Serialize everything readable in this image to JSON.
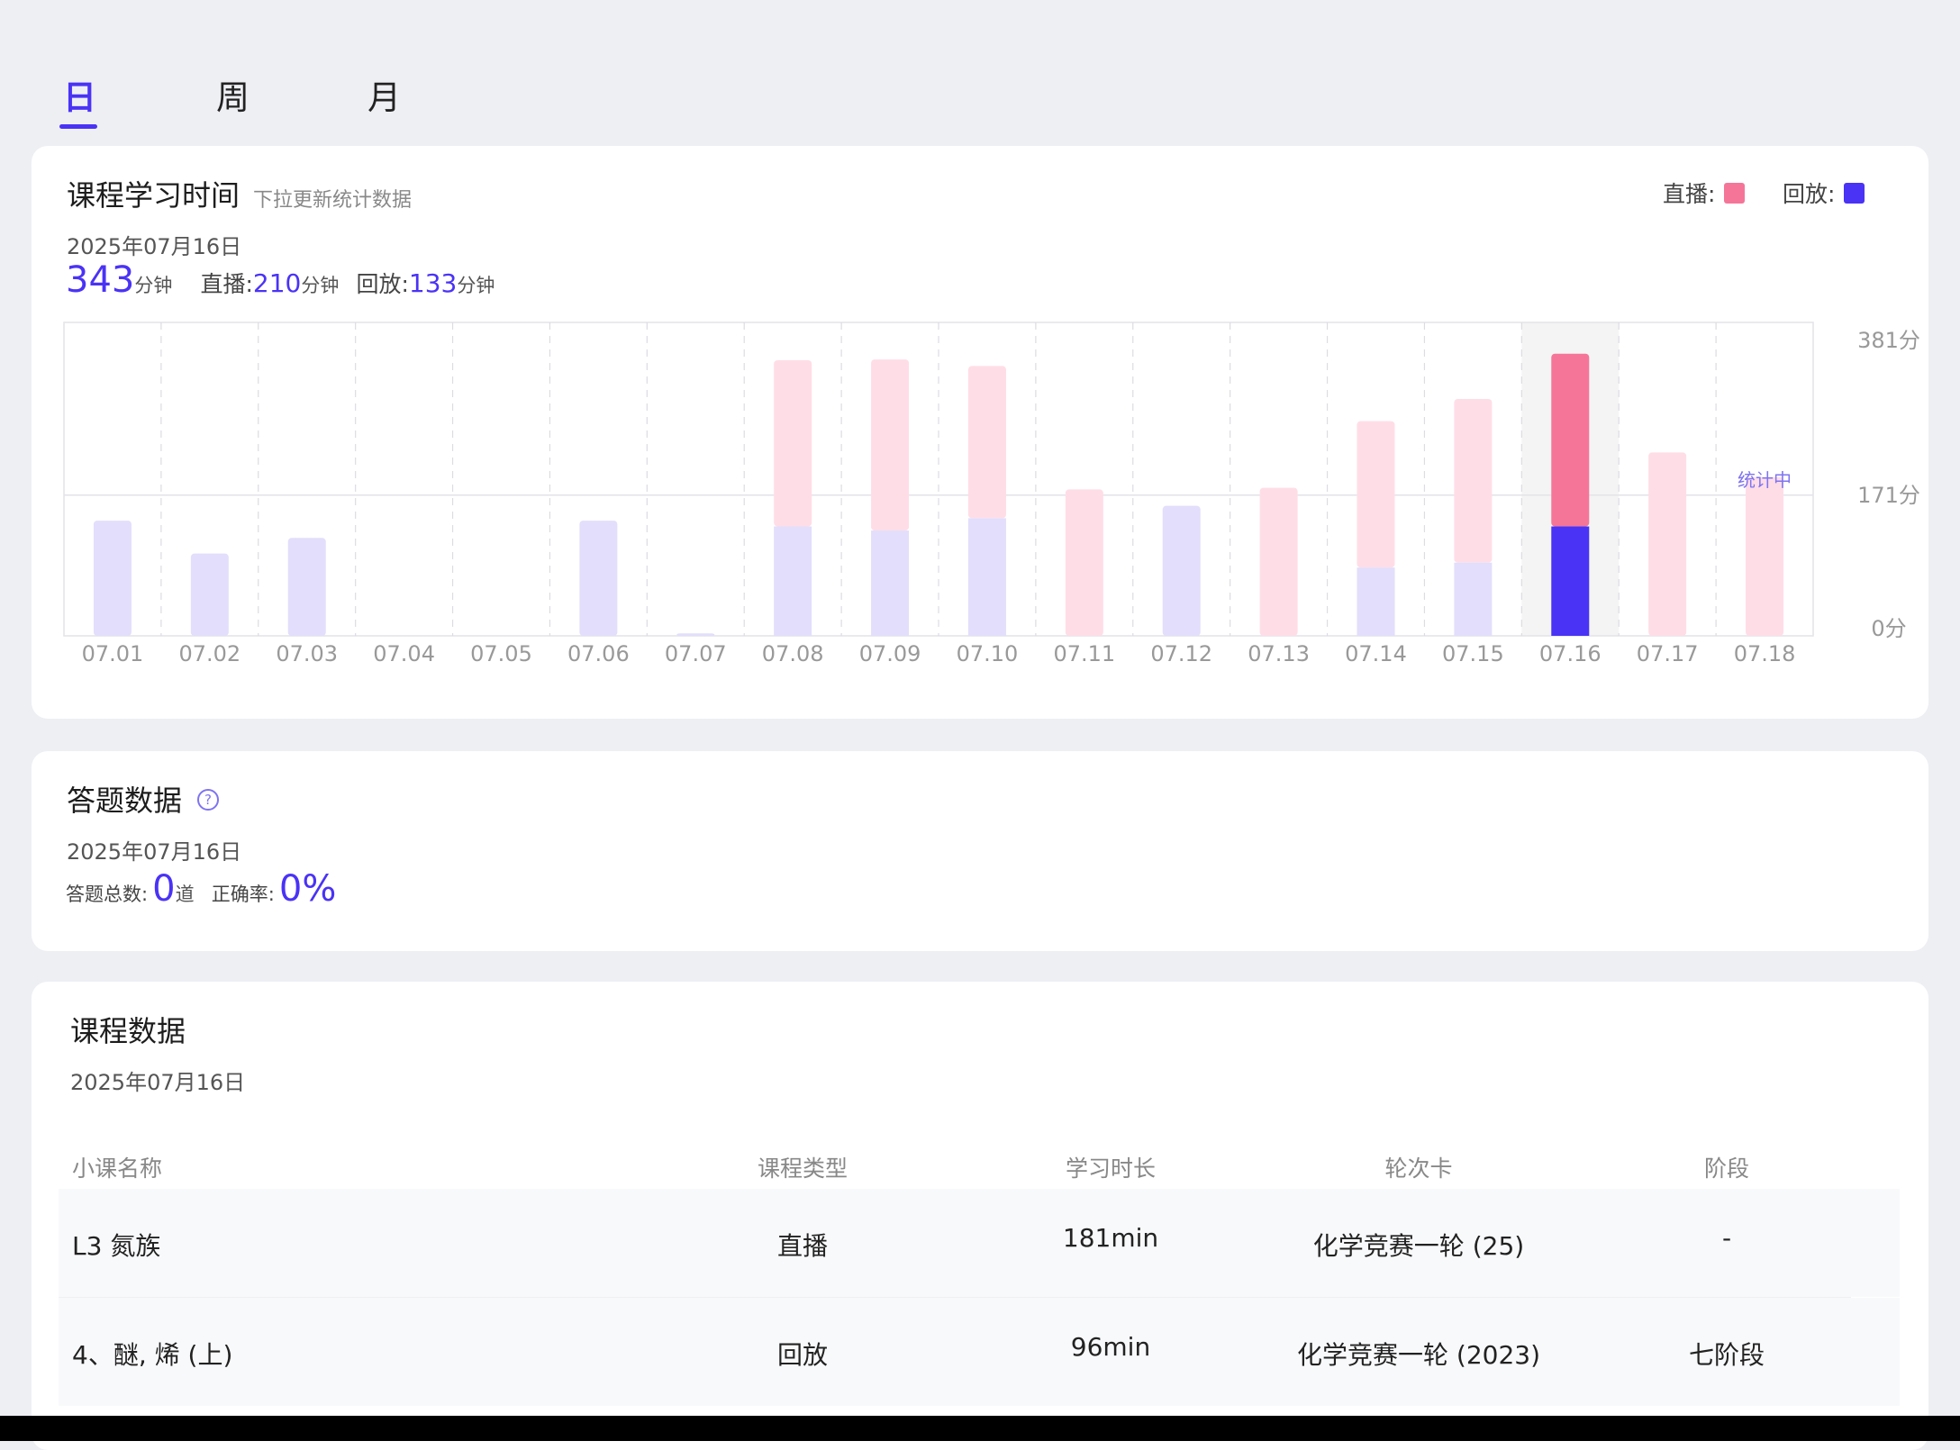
{
  "tabs": [
    {
      "label": "日",
      "active": true
    },
    {
      "label": "周",
      "active": false
    },
    {
      "label": "月",
      "active": false
    }
  ],
  "study": {
    "title": "课程学习时间",
    "hint": "下拉更新统计数据",
    "legend": {
      "live_label": "直播:",
      "replay_label": "回放:"
    },
    "date": "2025年07月16日",
    "total": "343",
    "total_unit": "分钟",
    "live_label": "直播:",
    "live_value": "210",
    "live_unit": "分钟",
    "replay_label": "回放:",
    "replay_value": "133",
    "replay_unit": "分钟"
  },
  "chart_data": {
    "type": "bar",
    "stacked": true,
    "categories": [
      "07.01",
      "07.02",
      "07.03",
      "07.04",
      "07.05",
      "07.06",
      "07.07",
      "07.08",
      "07.09",
      "07.10",
      "07.11",
      "07.12",
      "07.13",
      "07.14",
      "07.15",
      "07.16",
      "07.17",
      "07.18"
    ],
    "series": [
      {
        "name": "回放",
        "values": [
          140,
          100,
          119,
          0,
          0,
          140,
          3,
          133,
          128,
          143,
          0,
          158,
          0,
          83,
          89,
          133,
          0,
          0
        ]
      },
      {
        "name": "直播",
        "values": [
          0,
          0,
          0,
          0,
          0,
          0,
          0,
          202,
          208,
          185,
          178,
          0,
          180,
          178,
          199,
          210,
          223,
          193
        ]
      }
    ],
    "y_ticks": [
      "381分",
      "171分",
      "0分"
    ],
    "ylim": [
      0,
      381
    ],
    "highlight": "07.16",
    "annotation": {
      "category": "07.18",
      "text": "统计中"
    },
    "colors": {
      "live": "#ffdde7",
      "replay": "#e2defb",
      "live_active": "#f57599",
      "replay_active": "#4a33f5",
      "highlight_bg": "#f4f4f4"
    }
  },
  "answer": {
    "title": "答题数据",
    "date": "2025年07月16日",
    "total_label": "答题总数:",
    "total_value": "0",
    "total_unit": "道",
    "rate_label": "正确率:",
    "rate_value": "0%"
  },
  "course": {
    "title": "课程数据",
    "date": "2025年07月16日",
    "headers": [
      "小课名称",
      "课程类型",
      "学习时长",
      "轮次卡",
      "阶段"
    ],
    "rows": [
      [
        "L3 氮族",
        "直播",
        "181min",
        "化学竞赛一轮 (25)",
        "-"
      ],
      [
        "4、醚, 烯 (上)",
        "回放",
        "96min",
        "化学竞赛一轮 (2023)",
        "七阶段"
      ]
    ]
  },
  "colors": {
    "accent": "#4a33f5",
    "live": "#f57599",
    "replay": "#4a33f5"
  }
}
